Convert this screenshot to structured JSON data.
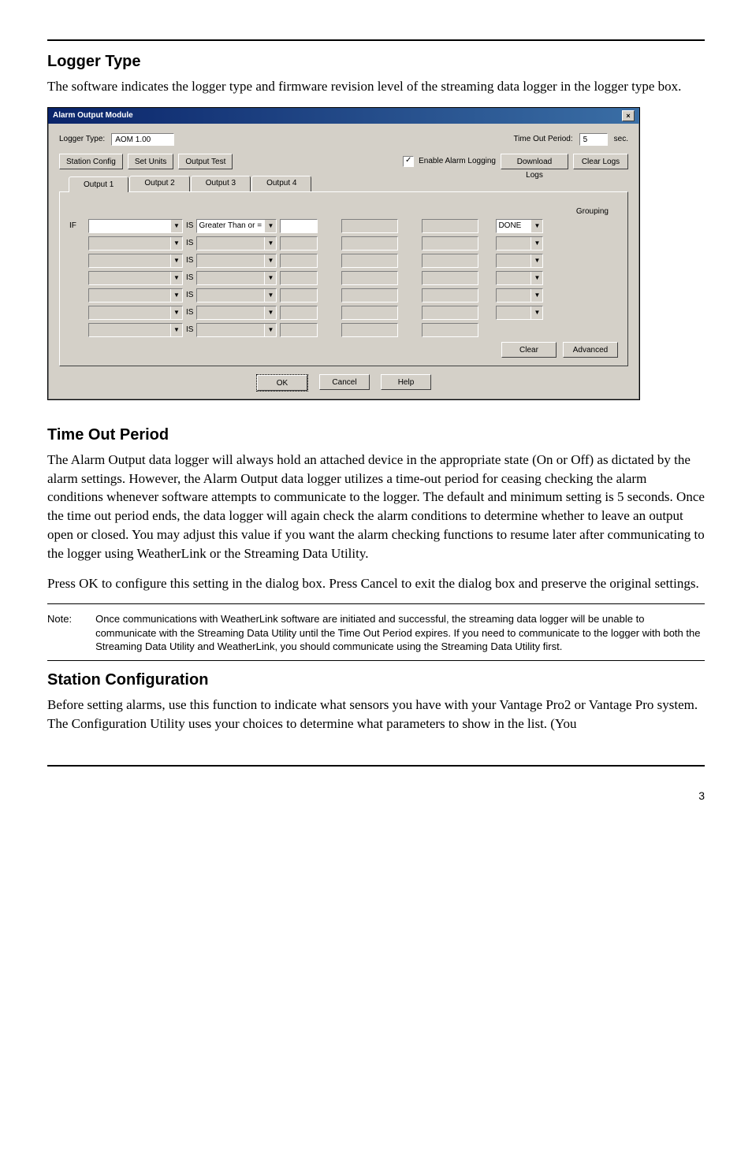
{
  "sections": {
    "logger_type": {
      "heading": "Logger Type",
      "para": "The software indicates the logger type and firmware revision level of the streaming data logger in the logger type box."
    },
    "timeout": {
      "heading": "Time Out Period",
      "para1": "The Alarm Output data logger will always hold an attached device in the appropriate state (On or Off) as dictated by the alarm settings. However, the Alarm Output data logger utilizes a time-out period for ceasing checking the alarm conditions whenever software attempts to communicate to the logger. The default and minimum setting is 5 seconds. Once the time out period ends, the data logger will again check the alarm conditions to determine whether to leave an output open or closed. You may adjust this value if you want the alarm checking functions to resume later after communicating to the logger using WeatherLink or the Streaming Data Utility.",
      "para2": "Press OK to configure this setting in the dialog box. Press Cancel to exit the dialog box and preserve the original settings."
    },
    "station": {
      "heading": "Station Configuration",
      "para": "Before setting alarms, use this function to indicate what sensors you have with your Vantage Pro2 or Vantage Pro system. The Configuration Utility uses your choices to determine what parameters to show in the list. (You"
    }
  },
  "note": {
    "label": "Note:",
    "text": "Once communications with WeatherLink software are initiated and successful, the streaming data logger will be unable to communicate with the Streaming Data Utility until the Time Out Period expires. If you need to communicate to the logger with both the Streaming Data Utility and WeatherLink, you should communicate using the Streaming Data Utility first."
  },
  "dialog": {
    "title": "Alarm Output Module",
    "logger_type_label": "Logger Type:",
    "logger_type_value": "AOM 1.00",
    "timeout_label": "Time Out Period:",
    "timeout_value": "5",
    "timeout_unit": "sec.",
    "btn_station_config": "Station Config",
    "btn_set_units": "Set Units",
    "btn_output_test": "Output Test",
    "chk_enable_label": "Enable Alarm Logging",
    "btn_download_logs": "Download Logs",
    "btn_clear_logs": "Clear Logs",
    "tabs": [
      "Output 1",
      "Output 2",
      "Output 3",
      "Output 4"
    ],
    "if_label": "IF",
    "is_label": "IS",
    "cmp_value": "Greater Than or =",
    "grouping_label": "Grouping",
    "grouping_value": "DONE",
    "btn_clear": "Clear",
    "btn_advanced": "Advanced",
    "btn_ok": "OK",
    "btn_cancel": "Cancel",
    "btn_help": "Help"
  },
  "page_number": "3"
}
